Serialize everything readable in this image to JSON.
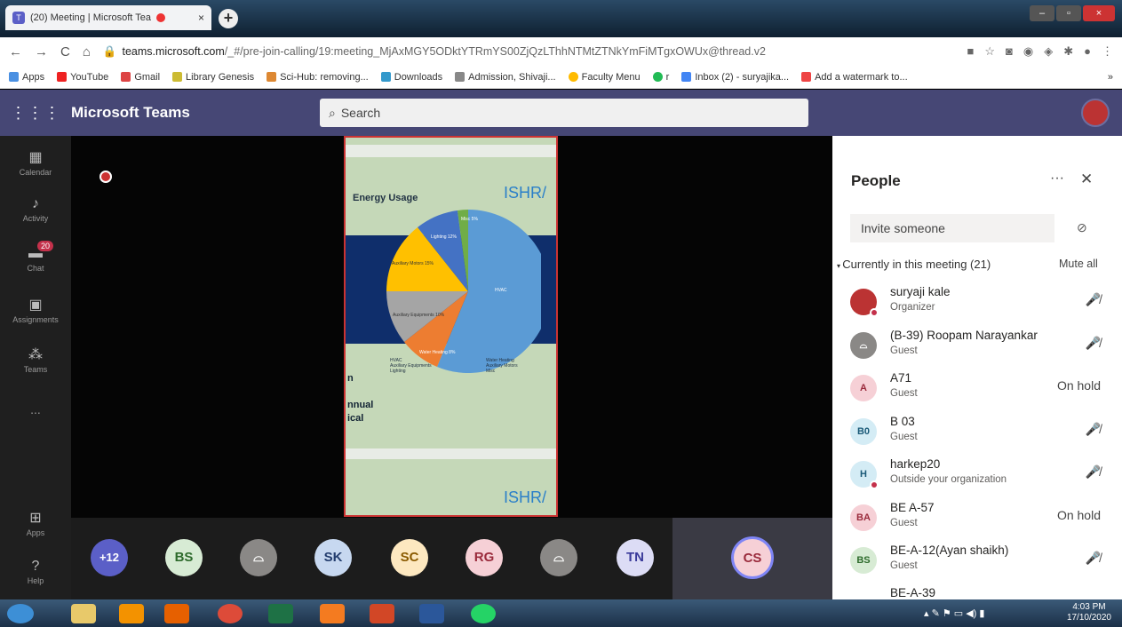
{
  "browser": {
    "tab_title": "(20) Meeting | Microsoft Tea",
    "url_domain": "teams.microsoft.com",
    "url_path": "/_#/pre-join-calling/19:meeting_MjAxMGY5ODktYTRmYS00ZjQzLThhNTMtZTNkYmFiMTgxOWUx@thread.v2"
  },
  "bookmarks": [
    "Apps",
    "YouTube",
    "Gmail",
    "Library Genesis",
    "Sci-Hub: removing...",
    "Downloads",
    "Admission, Shivaji...",
    "Faculty Menu",
    "r",
    "Inbox (2) - suryajika...",
    "Add a watermark to...",
    "»"
  ],
  "teams": {
    "title": "Microsoft Teams",
    "search_placeholder": "Search"
  },
  "rail": [
    {
      "label": "Calendar"
    },
    {
      "label": "Activity"
    },
    {
      "label": "Chat",
      "badge": "20"
    },
    {
      "label": "Assignments"
    },
    {
      "label": "Teams"
    },
    {
      "label": "..."
    },
    {
      "label": "Apps"
    },
    {
      "label": "Help"
    }
  ],
  "slide": {
    "title": "Energy Usage",
    "logo": "ISHR/",
    "text1": "n",
    "text2": "nnual",
    "text3": "ical",
    "pie_labels": [
      "Lighting 12%",
      "Misc 5%",
      "Auxiliary Motors 15%",
      "HVAC",
      "Auxiliary Equipments 10%",
      "Water Heating 8%"
    ],
    "legend": [
      "HVAC",
      "Auxiliary Equipments",
      "Lighting",
      "Water Heating",
      "Auxiliary Motors",
      "Misc"
    ]
  },
  "participants": [
    "+12",
    "BS",
    "",
    "SK",
    "SC",
    "RG",
    "",
    "TN",
    "CS"
  ],
  "people": {
    "title": "People",
    "invite": "Invite someone",
    "section": "Currently in this meeting (21)",
    "mute_all": "Mute all",
    "list": [
      {
        "initials": "",
        "name": "suryaji kale",
        "role": "Organizer",
        "status": "mic-off"
      },
      {
        "initials": "",
        "name": "(B-39) Roopam Narayankar",
        "role": "Guest",
        "status": "mic-off"
      },
      {
        "initials": "A",
        "name": "A71",
        "role": "Guest",
        "status": "On hold"
      },
      {
        "initials": "B0",
        "name": "B 03",
        "role": "Guest",
        "status": "mic-off"
      },
      {
        "initials": "H",
        "name": "harkep20",
        "role": "Outside your organization",
        "status": "mic-off"
      },
      {
        "initials": "BA",
        "name": "BE A-57",
        "role": "Guest",
        "status": "On hold"
      },
      {
        "initials": "BS",
        "name": "BE-A-12(Ayan shaikh)",
        "role": "Guest",
        "status": "mic-off"
      },
      {
        "initials": "B",
        "name": "BE-A-39",
        "role": "",
        "status": "mic-off"
      }
    ]
  },
  "clock": {
    "time": "4:03 PM",
    "date": "17/10/2020"
  }
}
